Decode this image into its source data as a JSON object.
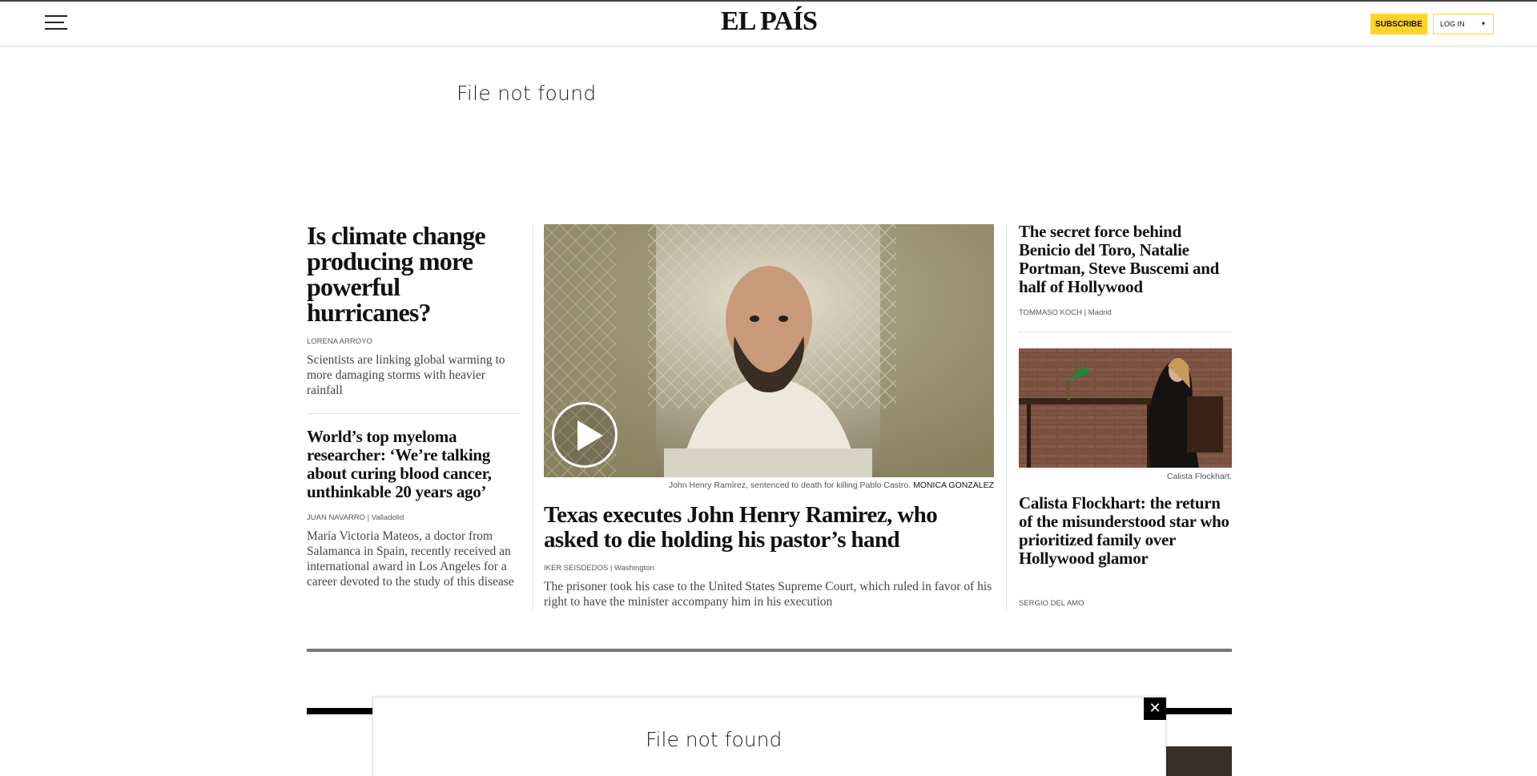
{
  "header": {
    "logo": "EL PAÍS",
    "subscribe_label": "SUBSCRIBE",
    "login_label": "LOG IN",
    "login_arrow": "▾"
  },
  "top_ad": {
    "message": "File not found"
  },
  "left_column": {
    "story1": {
      "headline": "Is climate change producing more powerful hurricanes?",
      "byline": "LORENA ARROYO",
      "summary": "Scientists are linking global warming to more damaging storms with heavier rainfall"
    },
    "story2": {
      "headline": "World’s top myeloma researcher: ‘We’re talking about curing blood cancer, unthinkable 20 years ago’",
      "byline_author": "JUAN NAVARRO",
      "byline_location": "| Valladolid",
      "summary": "María Victoria Mateos, a doctor from Salamanca in Spain, recently received an international award in Los Angeles for a career devoted to the study of this disease"
    }
  },
  "center_column": {
    "caption_text": "John Henry Ramírez, sentenced to death for killing Pablo Castro.",
    "caption_credit": "MONICA GONZALEZ",
    "headline": "Texas executes John Henry Ramirez, who asked to die holding his pastor’s hand",
    "byline_author": "IKER SEISDEDOS",
    "byline_location": "| Washington",
    "summary": "The prisoner took his case to the United States Supreme Court, which ruled in favor of his right to have the minister accompany him in his execution"
  },
  "right_column": {
    "story1": {
      "headline": "The secret force behind Benicio del Toro, Natalie Portman, Steve Buscemi and half of Hollywood",
      "byline_author": "TOMMASO KOCH",
      "byline_location": "| Madrid"
    },
    "story2": {
      "caption": "Calista Flockhart.",
      "headline": "Calista Flockhart: the return of the misunderstood star who prioritized family over Hollywood glamor",
      "byline": "SERGIO DEL AMO"
    }
  },
  "bottom_ad": {
    "message": "File not found",
    "close_label": "✕"
  }
}
